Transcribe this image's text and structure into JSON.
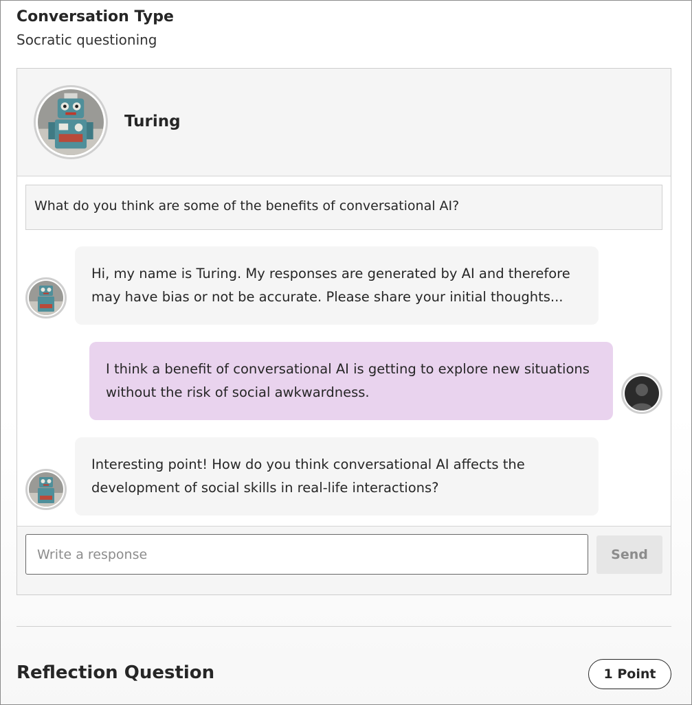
{
  "conversation": {
    "title": "Conversation Type",
    "type": "Socratic questioning"
  },
  "chat": {
    "bot_name": "Turing",
    "bot_avatar_icon": "robot-avatar-icon",
    "user_avatar_icon": "user-silhouette-icon",
    "question": "What do you think are some of the benefits of conversational AI?",
    "messages": [
      {
        "role": "bot",
        "text": "Hi, my name is Turing. My responses are generated by AI and therefore may have bias or not be accurate. Please share your initial thoughts..."
      },
      {
        "role": "user",
        "text": "I think a benefit of conversational AI is getting to explore new situations without the risk of social awkwardness."
      },
      {
        "role": "bot",
        "text": "Interesting point! How do you think conversational AI affects the development of social skills in real-life interactions?"
      }
    ],
    "input_placeholder": "Write a response",
    "send_label": "Send"
  },
  "reflection": {
    "title": "Reflection Question",
    "points": "1 Point"
  },
  "colors": {
    "user_bubble": "#e9d3ee",
    "bot_bubble": "#f5f5f5",
    "header_bg": "#f5f5f5",
    "send_disabled": "#e6e6e6"
  }
}
